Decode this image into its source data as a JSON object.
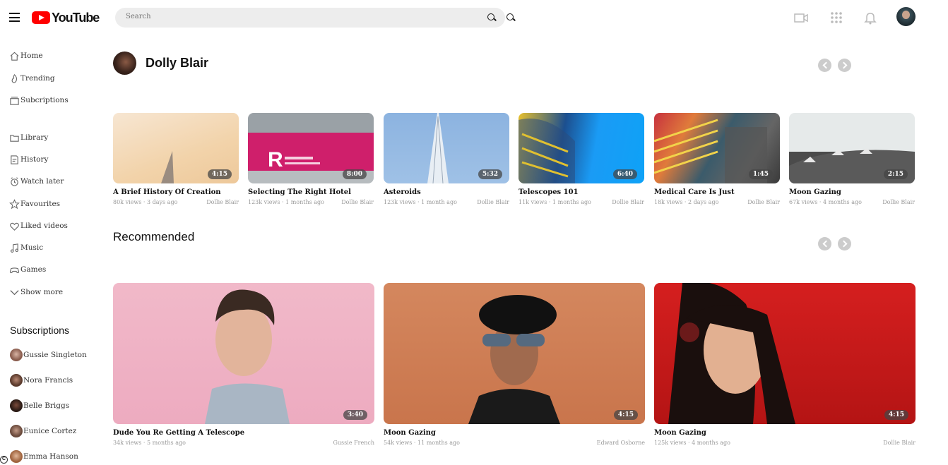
{
  "header": {
    "logo_text": "YouTube",
    "search_placeholder": "Search"
  },
  "sidebar": {
    "items": [
      {
        "label": "Home",
        "icon": "home-icon"
      },
      {
        "label": "Trending",
        "icon": "flame-icon"
      },
      {
        "label": "Subcriptions",
        "icon": "subscriptions-icon"
      },
      {
        "label": "Library",
        "icon": "folder-icon"
      },
      {
        "label": "History",
        "icon": "history-icon"
      },
      {
        "label": "Watch later",
        "icon": "clock-icon"
      },
      {
        "label": "Favourites",
        "icon": "star-icon"
      },
      {
        "label": "Liked videos",
        "icon": "heart-icon"
      },
      {
        "label": "Music",
        "icon": "music-icon"
      },
      {
        "label": "Games",
        "icon": "gamepad-icon"
      },
      {
        "label": "Show more",
        "icon": "chevron-down-icon"
      }
    ],
    "subscriptions_title": "Subscriptions",
    "subscriptions": [
      {
        "name": "Gussie Singleton"
      },
      {
        "name": "Nora Francis"
      },
      {
        "name": "Belle Briggs"
      },
      {
        "name": "Eunice Cortez"
      },
      {
        "name": "Emma Hanson"
      }
    ]
  },
  "channel": {
    "name": "Dolly Blair",
    "videos": [
      {
        "title": "A Brief History Of Creation",
        "views": "80k views",
        "age": "3 days ago",
        "author": "Dollie Blair",
        "duration": "4:15"
      },
      {
        "title": "Selecting The Right Hotel",
        "views": "123k views",
        "age": "1 months ago",
        "author": "Dollie Blair",
        "duration": "8:00"
      },
      {
        "title": "Asteroids",
        "views": "123k views",
        "age": "1 month ago",
        "author": "Dollie Blair",
        "duration": "5:32"
      },
      {
        "title": "Telescopes 101",
        "views": "11k views",
        "age": "1 months ago",
        "author": "Dollie Blair",
        "duration": "6:40"
      },
      {
        "title": "Medical Care Is Just",
        "views": "18k views",
        "age": "2 days ago",
        "author": "Dollie Blair",
        "duration": "1:45"
      },
      {
        "title": "Moon Gazing",
        "views": "67k views",
        "age": "4 months ago",
        "author": "Dollie Blair",
        "duration": "2:15"
      }
    ]
  },
  "recommended": {
    "title": "Recommended",
    "videos": [
      {
        "title": "Dude You Re Getting A Telescope",
        "views": "34k views",
        "age": "5 months ago",
        "author": "Gussie French",
        "duration": "3:40"
      },
      {
        "title": "Moon Gazing",
        "views": "54k views",
        "age": "11 months ago",
        "author": "Edward Osborne",
        "duration": "4:15"
      },
      {
        "title": "Moon Gazing",
        "views": "125k views",
        "age": "4 months ago",
        "author": "Dollie Blair",
        "duration": "4:15"
      }
    ]
  },
  "footer": {
    "corner_mark": "C"
  }
}
